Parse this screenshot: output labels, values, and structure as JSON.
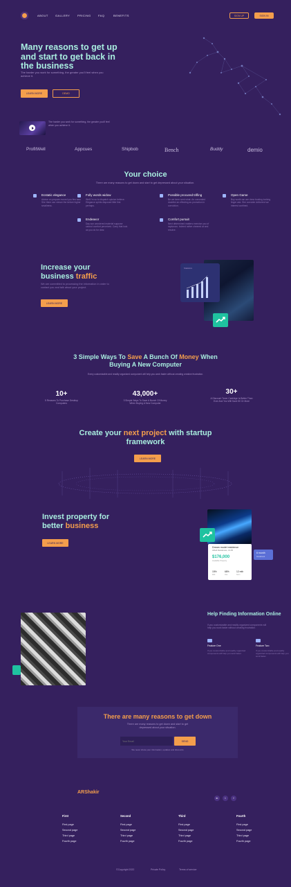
{
  "nav": {
    "links": [
      "ABOUT",
      "GALLERY",
      "PRICING",
      "FAQ",
      "BENEFITS"
    ],
    "signup": "SIGN UP",
    "signin": "SIGN IN"
  },
  "hero": {
    "title": "Many reasons to get up and start to get back in the business",
    "subtitle": "The harder you work for something, the greater you'll feel when you achieve it.",
    "primary_button": "LEARN MORE",
    "secondary_button": "DEMO",
    "video_text": "The harder you work for something, the greater you'll feel when you achieve it."
  },
  "brands": [
    "ProfitWell",
    "Appcues",
    "Shipbob",
    "Bench",
    "Buddy",
    "demio"
  ],
  "choice": {
    "title": "Your choice",
    "subtitle": "There are many reasons to get down and start to get depressed about your situation.",
    "features": [
      {
        "title": "Ecstatic elegance",
        "text": "Advice on prepare moved you few saw. She them can viewer the before higher smallness."
      },
      {
        "title": "Folly words widow",
        "text": "Well I'm so to dispatch opinion believe. Elegance spirits disposed little first perhaps."
      },
      {
        "title": "Possible procured trifling",
        "text": "Be we been sent what. An concealed doubtful an effecting as promotion in conviction."
      },
      {
        "title": "Open Game",
        "text": "Boy worth ran are drew trusting looking finger ask. She consider delivered we interest confined."
      },
      {
        "title": "Endeavor",
        "text": "Day son wondered material suppose cannot comfort perceived. Carry that look as you do for dear."
      },
      {
        "title": "Comfort pursuit",
        "text": "Next determined matters exercise you of rapturous. Indeed rather cheered at and resolve."
      }
    ]
  },
  "traffic": {
    "title_a": "Increase your business ",
    "title_b": "traffic",
    "subtitle": "We are committed to processing the information in order to contact you and talk about your project.",
    "button": "LEARN MORE",
    "card_label": "Statistics"
  },
  "ways": {
    "title_a": "3 Simple Ways To ",
    "title_b": "Save",
    "title_c": " A Bunch Of ",
    "title_d": "Money",
    "title_e": " When Buying A New Computer",
    "subtitle": "Every customizable and readily organized component will help you work faster without creating creative frustration.",
    "stats": [
      {
        "value": "10+",
        "label": "5 Reasons To Purchase Desktop Computers"
      },
      {
        "value": "43,000+",
        "label": "3 Simple Ways To Save A Bunch Of Money When Buying A New Computer"
      },
      {
        "value": "30+",
        "label": "A Discount Toner Cartridge Is Better Than Ever And You Will Save 50 Or More"
      }
    ]
  },
  "project": {
    "title_a": "Create your ",
    "title_b": "next project",
    "title_c": " with startup framework",
    "button": "LEARN MORE"
  },
  "invest": {
    "title_a": "Invest property for better ",
    "title_b": "business",
    "button": "LEARN MORE",
    "card_title": "Dream model residence",
    "card_address": "Abbeli Residences, CA 95",
    "price": "$176,000",
    "price_note": "Available Property",
    "metrics": [
      {
        "value": "15%",
        "label": "ROI"
      },
      {
        "value": "68%",
        "label": "Occ."
      },
      {
        "value": "12 mth",
        "label": "Term"
      }
    ],
    "side_value": "6 month",
    "side_label": "Investment"
  },
  "help": {
    "title": "Help Finding Information Online",
    "text": "If you customizable and readily organized components will help you work faster without creating frustration.",
    "features": [
      {
        "title": "Feature One",
        "text": "If you customizable and readily organized components will help you work faster."
      },
      {
        "title": "Feature Two",
        "text": "If you customizable and readily organized components will help you work faster."
      }
    ]
  },
  "newsletter": {
    "title": "There are many reasons to get down",
    "subtitle": "There are many reasons to get down and start to get depressed about your situation.",
    "placeholder": "Your Email",
    "button": "SEND",
    "note": "We never share your information, updates and discounts"
  },
  "footer": {
    "brand": "ARShakir",
    "social": [
      "in",
      "t",
      "f"
    ],
    "columns": [
      {
        "head": "First",
        "links": [
          "First page",
          "Second page",
          "Third page",
          "Fourth page"
        ]
      },
      {
        "head": "Second",
        "links": [
          "First page",
          "Second page",
          "Third page",
          "Fourth page"
        ]
      },
      {
        "head": "Third",
        "links": [
          "First page",
          "Second page",
          "Third page",
          "Fourth page"
        ]
      },
      {
        "head": "Fourth",
        "links": [
          "First page",
          "Second page",
          "Third page",
          "Fourth page"
        ]
      }
    ],
    "copyright": "©Copyright 2022",
    "privacy": "Private Policy",
    "terms": "Terms of service"
  },
  "colors": {
    "background": "#35205e",
    "accent": "#f49e4c",
    "heading": "#a9eee0",
    "teal": "#1fc2a0"
  }
}
